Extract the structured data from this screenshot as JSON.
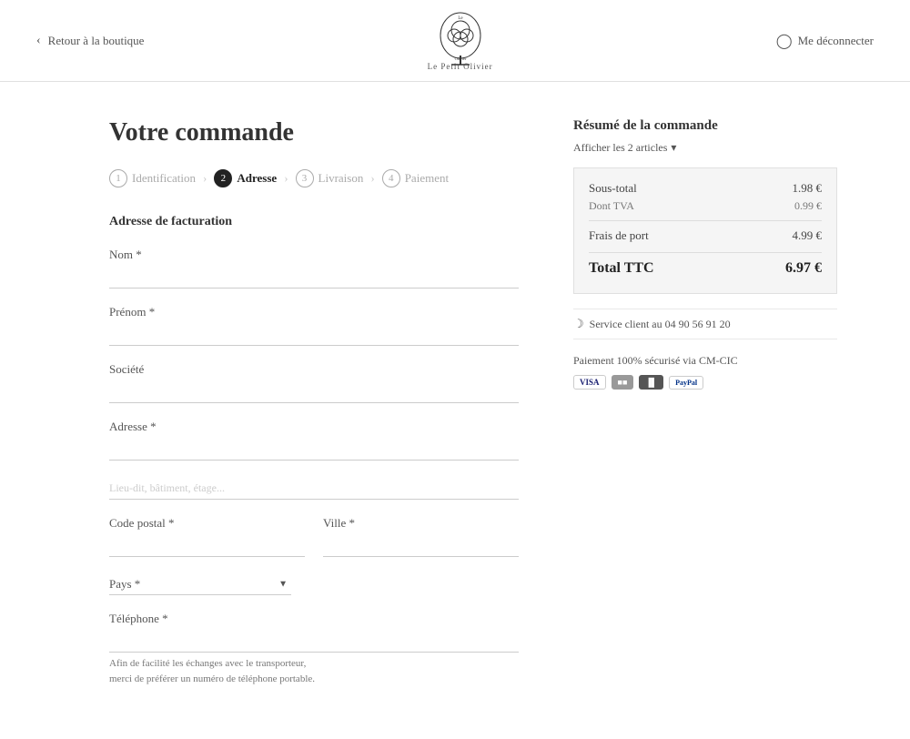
{
  "header": {
    "back_label": "Retour à la boutique",
    "brand_name": "Le Petit Olivier",
    "logout_label": "Me déconnecter"
  },
  "page": {
    "title": "Votre commande"
  },
  "steps": [
    {
      "num": "1",
      "label": "Identification",
      "active": false
    },
    {
      "num": "2",
      "label": "Adresse",
      "active": true
    },
    {
      "num": "3",
      "label": "Livraison",
      "active": false
    },
    {
      "num": "4",
      "label": "Paiement",
      "active": false
    }
  ],
  "form": {
    "section_title": "Adresse de facturation",
    "fields": {
      "nom_label": "Nom *",
      "prenom_label": "Prénom *",
      "societe_label": "Société",
      "adresse_label": "Adresse *",
      "lieu_dit_label": "Lieu-dit, bâtiment, étage...",
      "code_postal_label": "Code postal *",
      "ville_label": "Ville *",
      "pays_label": "Pays *",
      "telephone_label": "Téléphone *",
      "telephone_note": "Afin de facilité les échanges avec le transporteur,\nmerci de préférer un numéro de téléphone portable."
    }
  },
  "summary": {
    "title": "Résumé de la commande",
    "show_articles": "Afficher les 2 articles",
    "sous_total_label": "Sous-total",
    "sous_total_value": "1.98 €",
    "dont_tva_label": "Dont TVA",
    "dont_tva_value": "0.99 €",
    "frais_port_label": "Frais de port",
    "frais_port_value": "4.99 €",
    "total_label": "Total TTC",
    "total_value": "6.97 €",
    "service_client": "Service client au 04 90 56 91 20",
    "paiement_label": "Paiement 100% sécurisé via CM-CIC",
    "payment_cards": [
      "VISA",
      "MC",
      "MC2",
      "PayPal"
    ]
  }
}
